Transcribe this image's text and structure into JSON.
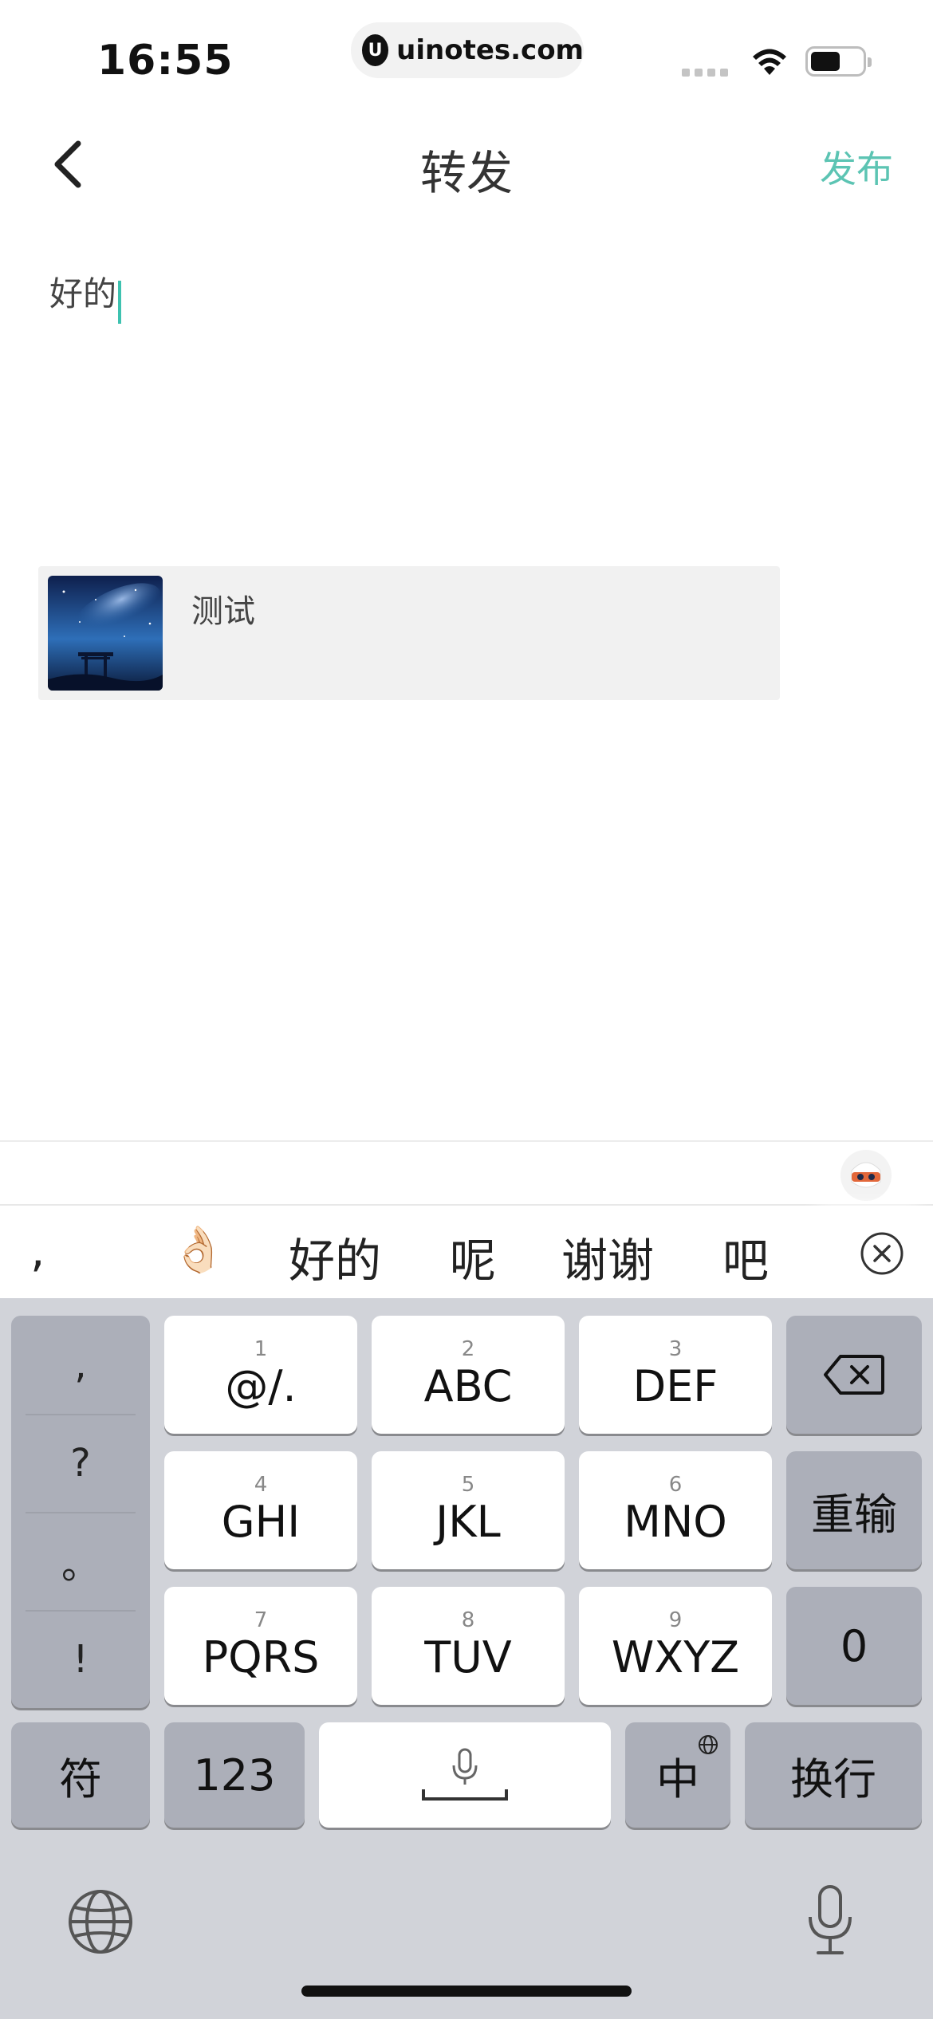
{
  "status_bar": {
    "time": "16:55",
    "url": "uinotes.com",
    "url_logo": "U"
  },
  "nav": {
    "title": "转发",
    "publish_label": "发布"
  },
  "composer": {
    "text": "好的"
  },
  "shared_card": {
    "title": "测试"
  },
  "candidates": [
    ",",
    "👌🏻",
    "好的",
    "呢",
    "谢谢",
    "吧"
  ],
  "keyboard": {
    "punctuation": [
      ",",
      "?",
      "。",
      "!"
    ],
    "keys": [
      {
        "num": "1",
        "letters": "@/."
      },
      {
        "num": "2",
        "letters": "ABC"
      },
      {
        "num": "3",
        "letters": "DEF"
      },
      {
        "num": "4",
        "letters": "GHI"
      },
      {
        "num": "5",
        "letters": "JKL"
      },
      {
        "num": "6",
        "letters": "MNO"
      },
      {
        "num": "7",
        "letters": "PQRS"
      },
      {
        "num": "8",
        "letters": "TUV"
      },
      {
        "num": "9",
        "letters": "WXYZ"
      }
    ],
    "reenter_label": "重输",
    "zero_label": "0",
    "symbols_label": "符",
    "numbers_label": "123",
    "lang_label": "中",
    "return_label": "换行"
  },
  "colors": {
    "accent": "#5cc4b3",
    "keyboard_bg": "#d1d3d9"
  }
}
